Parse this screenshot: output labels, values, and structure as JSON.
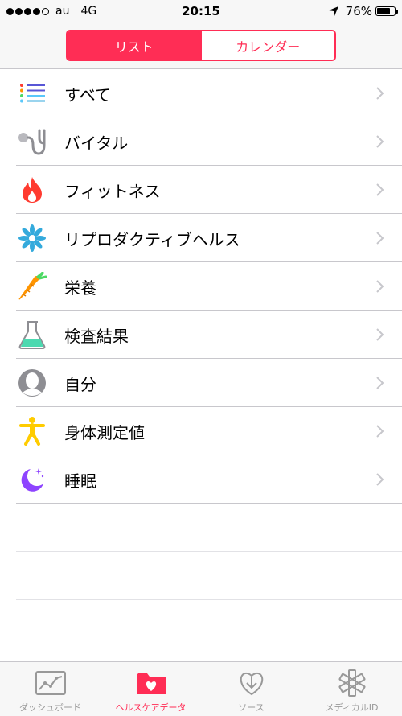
{
  "status_bar": {
    "carrier": "au",
    "network": "4G",
    "time": "20:15",
    "battery_percent": "76%",
    "battery_level": 0.76,
    "signal_bars_filled": 4,
    "signal_bars_total": 5
  },
  "segmented_control": {
    "active": "リスト",
    "inactive": "カレンダー"
  },
  "categories": [
    {
      "label": "すべて",
      "icon": "list-icon"
    },
    {
      "label": "バイタル",
      "icon": "stethoscope-icon"
    },
    {
      "label": "フィットネス",
      "icon": "flame-icon"
    },
    {
      "label": "リプロダクティブヘルス",
      "icon": "snowflake-flower-icon"
    },
    {
      "label": "栄養",
      "icon": "carrot-icon"
    },
    {
      "label": "検査結果",
      "icon": "flask-icon"
    },
    {
      "label": "自分",
      "icon": "person-silhouette-icon"
    },
    {
      "label": "身体測定値",
      "icon": "body-figure-icon"
    },
    {
      "label": "睡眠",
      "icon": "moon-icon"
    }
  ],
  "tab_bar": {
    "dashboard": "ダッシュボード",
    "health_data": "ヘルスケアデータ",
    "sources": "ソース",
    "medical_id": "メディカルID",
    "active_tab": "ヘルスケアデータ"
  },
  "colors": {
    "accent": "#ff2d55",
    "inactive_tab": "#999999",
    "chevron": "#c7c7cc"
  }
}
